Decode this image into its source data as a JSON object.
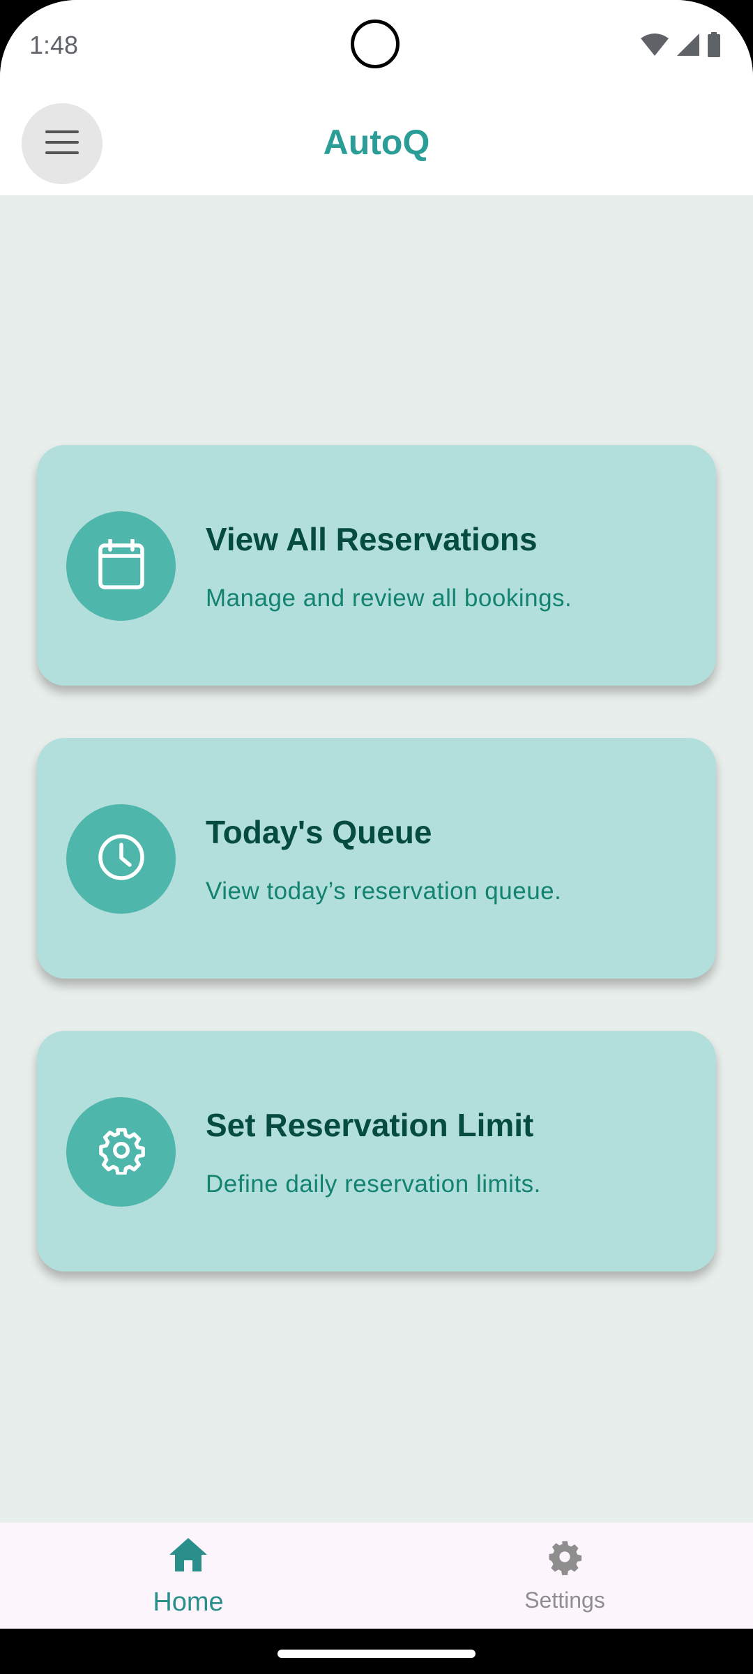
{
  "status_bar": {
    "time": "1:48"
  },
  "app_bar": {
    "title": "AutoQ",
    "menu_icon": "hamburger-menu-icon"
  },
  "cards": [
    {
      "title": "View All Reservations",
      "subtitle": "Manage and review all bookings.",
      "icon": "calendar-icon"
    },
    {
      "title": "Today's Queue",
      "subtitle": "View today’s reservation queue.",
      "icon": "clock-icon"
    },
    {
      "title": "Set Reservation Limit",
      "subtitle": "Define daily reservation limits.",
      "icon": "gear-icon"
    }
  ],
  "bottom_nav": {
    "items": [
      {
        "label": "Home",
        "icon": "home-icon",
        "selected": true
      },
      {
        "label": "Settings",
        "icon": "settings-gear-icon",
        "selected": false
      }
    ]
  },
  "colors": {
    "accent": "#2a9d97",
    "card_background": "#b2dfdc",
    "icon_circle": "#4fb6ac",
    "card_title": "#064b40",
    "card_subtitle": "#13826f",
    "page_background": "#e8eeeb",
    "nav_background": "#fcf5fc"
  }
}
